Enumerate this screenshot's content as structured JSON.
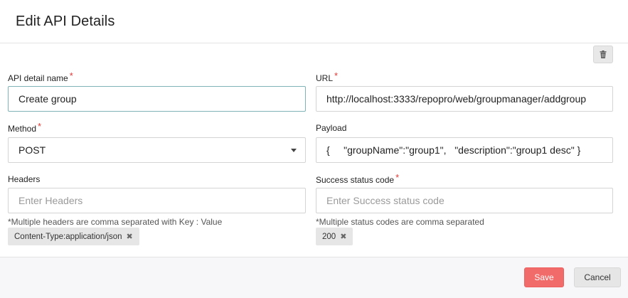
{
  "modal": {
    "title": "Edit API Details"
  },
  "toolbar": {
    "delete_icon": "trash-icon"
  },
  "form": {
    "api_name": {
      "label": "API detail name",
      "required_mark": "*",
      "value": "Create group"
    },
    "url": {
      "label": "URL",
      "required_mark": "*",
      "value": "http://localhost:3333/repopro/web/groupmanager/addgroup"
    },
    "method": {
      "label": "Method",
      "required_mark": "*",
      "value": "POST",
      "caret_icon": "caret-down-icon"
    },
    "payload": {
      "label": "Payload",
      "value": "{     \"groupName\":\"group1\",   \"description\":\"group1 desc\" }"
    },
    "headers": {
      "label": "Headers",
      "placeholder": "Enter Headers",
      "hint": "*Multiple headers are comma separated with Key : Value",
      "chips": [
        {
          "text": "Content-Type:application/json",
          "remove": "✖"
        }
      ]
    },
    "success_code": {
      "label": "Success status code",
      "required_mark": "*",
      "placeholder": "Enter Success status code",
      "hint": "*Multiple status codes are comma separated",
      "chips": [
        {
          "text": "200",
          "remove": "✖"
        }
      ]
    }
  },
  "footer": {
    "save_label": "Save",
    "cancel_label": "Cancel"
  },
  "colors": {
    "accent_save": "#f26b6b",
    "required": "#e53935",
    "focus_border": "#7fb3b7"
  }
}
